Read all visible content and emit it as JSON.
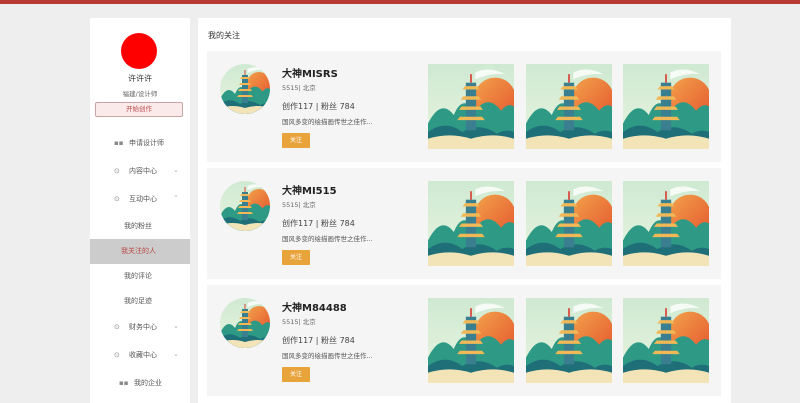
{
  "colors": {
    "accent": "#b73a33",
    "follow_button": "#e8a33a",
    "active_nav_bg": "#cccccc"
  },
  "profile": {
    "name": "许许许",
    "title": "福建/设计师",
    "create_button": "开始创作"
  },
  "sidebar": {
    "items": [
      {
        "label": "申请设计师",
        "icon": "grid-icon"
      },
      {
        "label": "内容中心",
        "icon": "location-pin-icon",
        "chevron": "⌄"
      },
      {
        "label": "互动中心",
        "icon": "location-pin-icon",
        "chevron": "⌃"
      },
      {
        "label": "我的粉丝"
      },
      {
        "label": "我关注的人"
      },
      {
        "label": "我的评论"
      },
      {
        "label": "我的足迹"
      },
      {
        "label": "财务中心",
        "icon": "location-pin-icon",
        "chevron": "⌄"
      },
      {
        "label": "收藏中心",
        "icon": "location-pin-icon",
        "chevron": "⌄"
      },
      {
        "label": "我的企业",
        "icon": "grid-icon"
      }
    ]
  },
  "main": {
    "title": "我的关注",
    "cards": [
      {
        "name": "大神MISRS",
        "meta": "5515| 北京",
        "stats": "创作117 | 粉丝 784",
        "desc": "国风多变的绘描画传世之佳作...",
        "follow": "关注"
      },
      {
        "name": "大神MI515",
        "meta": "5515| 北京",
        "stats": "创作117 | 粉丝 784",
        "desc": "国风多变的绘描画传世之佳作...",
        "follow": "关注"
      },
      {
        "name": "大神M84488",
        "meta": "5515| 北京",
        "stats": "创作117 | 粉丝 784",
        "desc": "国风多变的绘描画传世之佳作...",
        "follow": "关注"
      }
    ]
  }
}
